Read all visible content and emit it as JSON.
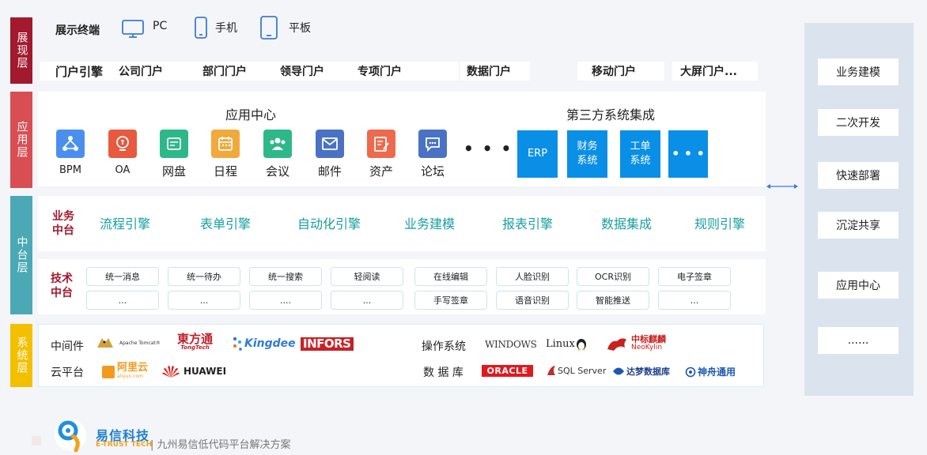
{
  "layers": {
    "presentation": "展现层",
    "application": "应用层",
    "middle": "中台层",
    "system": "系统层"
  },
  "terminals": {
    "label": "展示终端",
    "pc": "PC",
    "phone": "手机",
    "tablet": "平板"
  },
  "portals": [
    "门户引擎",
    "公司门户",
    "部门门户",
    "领导门户",
    "专项门户",
    "数据门户",
    "移动门户",
    "大屏门户..."
  ],
  "app_center": {
    "title": "应用中心",
    "apps": [
      "BPM",
      "OA",
      "网盘",
      "日程",
      "会议",
      "邮件",
      "资产",
      "论坛"
    ],
    "more": "• • •"
  },
  "third_party": {
    "title": "第三方系统集成",
    "items": [
      "ERP",
      "财务系统",
      "工单系统",
      "• • •"
    ]
  },
  "business_middle": {
    "label": "业务中台",
    "engines": [
      "流程引擎",
      "表单引擎",
      "自动化引擎",
      "业务建模",
      "报表引擎",
      "数据集成",
      "规则引擎"
    ]
  },
  "tech_middle": {
    "label": "技术中台",
    "row1": [
      "统一消息",
      "统一待办",
      "统一搜索",
      "轻阅读",
      "在线编辑",
      "人脸识别",
      "OCR识别",
      "电子签章"
    ],
    "row2": [
      "...",
      "...",
      "....",
      "...",
      "手写签章",
      "语音识别",
      "智能推送",
      "..."
    ]
  },
  "system": {
    "middleware_label": "中间件",
    "cloud_label": "云平台",
    "os_label": "操作系统",
    "db_label": "数 据 库",
    "middleware": [
      "Apache Tomcat®",
      "東方通",
      "TongTech",
      "Kingdee",
      "INFORS"
    ],
    "cloud": [
      "阿里云",
      "aliyun.com",
      "HUAWEI"
    ],
    "os": [
      "WINDOWS",
      "Linux",
      "中标麒麟",
      "NeoKylin"
    ],
    "db": [
      "ORACLE",
      "SQL Server",
      "达梦数据库",
      "神舟通用"
    ]
  },
  "right_panel": [
    "业务建模",
    "二次开发",
    "快速部署",
    "沉淀共享",
    "应用中心",
    "......"
  ],
  "footer": {
    "brand": "易信科技",
    "brand_en": "E-TRUST TECH",
    "slogan": "| 九州易信低代码平台解决方案"
  },
  "colors": {
    "presentation": "#a3192e",
    "application": "#d94e52",
    "middle": "#4aa9b5",
    "system": "#f3c000",
    "accent_blue": "#0a8fe6",
    "engine_text": "#1a9e9e",
    "label_red": "#a3192e"
  }
}
